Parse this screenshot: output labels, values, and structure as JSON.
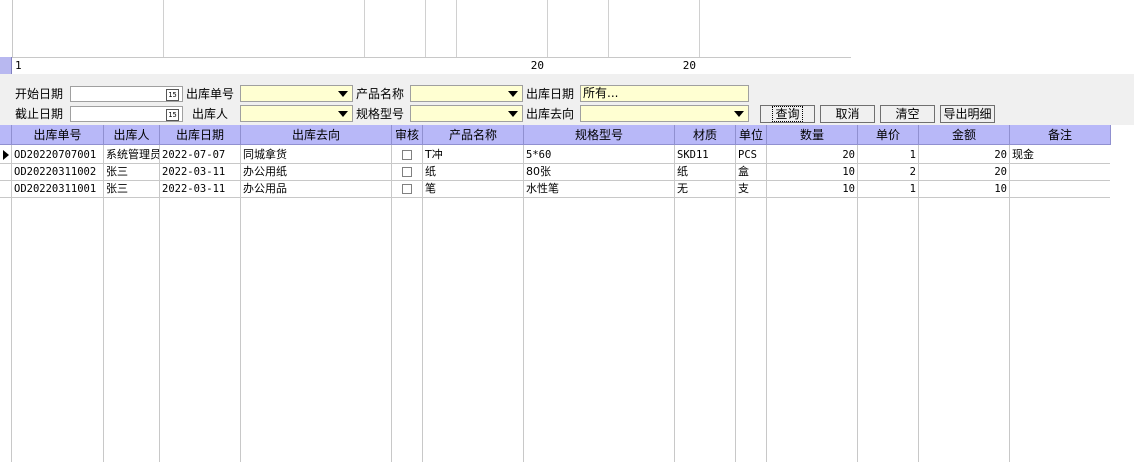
{
  "summary": {
    "count": "1",
    "qty_total": "20",
    "amount_total": "20"
  },
  "filters": {
    "start_date_label": "开始日期",
    "end_date_label": "截止日期",
    "order_no_label": "出库单号",
    "person_label": "出库人",
    "product_name_label": "产品名称",
    "spec_label": "规格型号",
    "out_date_label": "出库日期",
    "destination_label": "出库去向",
    "out_date_value": "所有...",
    "calendar_icon_text": "15"
  },
  "buttons": {
    "query": "查询",
    "cancel": "取消",
    "clear": "清空",
    "export": "导出明细"
  },
  "columns": [
    "出库单号",
    "出库人",
    "出库日期",
    "出库去向",
    "审核",
    "产品名称",
    "规格型号",
    "材质",
    "单位",
    "数量",
    "单价",
    "金额",
    "备注"
  ],
  "rows": [
    {
      "order_no": "OD20220707001",
      "person": "系统管理员",
      "date": "2022-07-07",
      "destination": "同城拿货",
      "product": "T冲",
      "spec": "5*60",
      "material": "SKD11",
      "unit": "PCS",
      "qty": "20",
      "price": "1",
      "amount": "20",
      "note": "现金"
    },
    {
      "order_no": "OD20220311002",
      "person": "张三",
      "date": "2022-03-11",
      "destination": "办公用纸",
      "product": "纸",
      "spec": "80张",
      "material": "纸",
      "unit": "盒",
      "qty": "10",
      "price": "2",
      "amount": "20",
      "note": ""
    },
    {
      "order_no": "OD20220311001",
      "person": "张三",
      "date": "2022-03-11",
      "destination": "办公用品",
      "product": "笔",
      "spec": "水性笔",
      "material": "无",
      "unit": "支",
      "qty": "10",
      "price": "1",
      "amount": "10",
      "note": ""
    }
  ],
  "colors": {
    "header_bg": "#b8b8f8",
    "combo_bg": "#ffffd2",
    "panel_bg": "#f0f0f0"
  }
}
